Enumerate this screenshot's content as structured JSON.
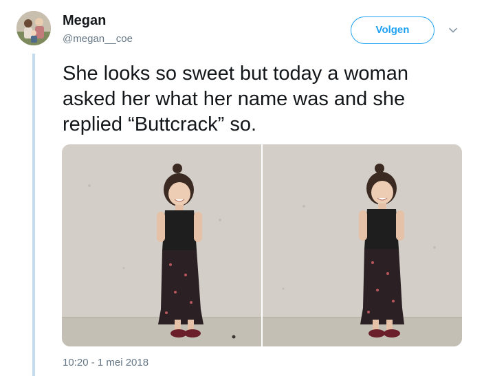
{
  "user": {
    "display_name": "Megan",
    "handle": "@megan__coe"
  },
  "follow_label": "Volgen",
  "tweet": {
    "lines": [
      "She looks so sweet but today a woman",
      "asked her what her name was and she",
      "replied “Buttcrack” so."
    ]
  },
  "timestamp": "10:20 - 1 mei 2018",
  "icons": {
    "menu": "chevron-down-icon"
  },
  "colors": {
    "accent": "#1da1f2",
    "secondary_text": "#657786",
    "thread_line": "#c4dbee"
  }
}
